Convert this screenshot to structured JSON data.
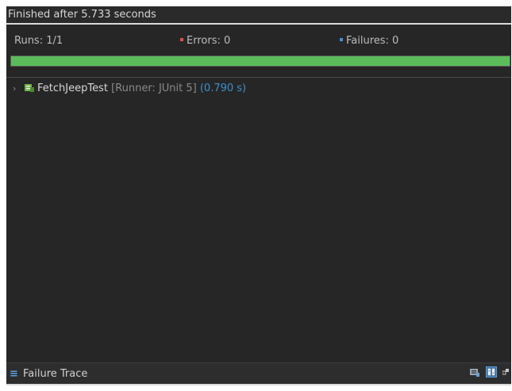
{
  "status": {
    "text": "Finished after 5.733 seconds"
  },
  "counters": {
    "runs": "Runs: 1/1",
    "errors": "Errors: 0",
    "failures": "Failures: 0"
  },
  "progress": {
    "value": 1.0,
    "color": "#5bbd5a"
  },
  "tree": {
    "items": [
      {
        "name": "FetchJeepTest",
        "runner": "[Runner: JUnit 5]",
        "time": "(0.790 s)"
      }
    ]
  },
  "footer": {
    "title": "Failure Trace"
  },
  "icons": {
    "error_marker": "error-marker-icon",
    "failure_marker": "failure-marker-icon",
    "class": "test-class-icon",
    "trace": "list-icon"
  },
  "colors": {
    "error": "#e05050",
    "failure": "#4a8fd8",
    "time": "#3d8fcc"
  }
}
